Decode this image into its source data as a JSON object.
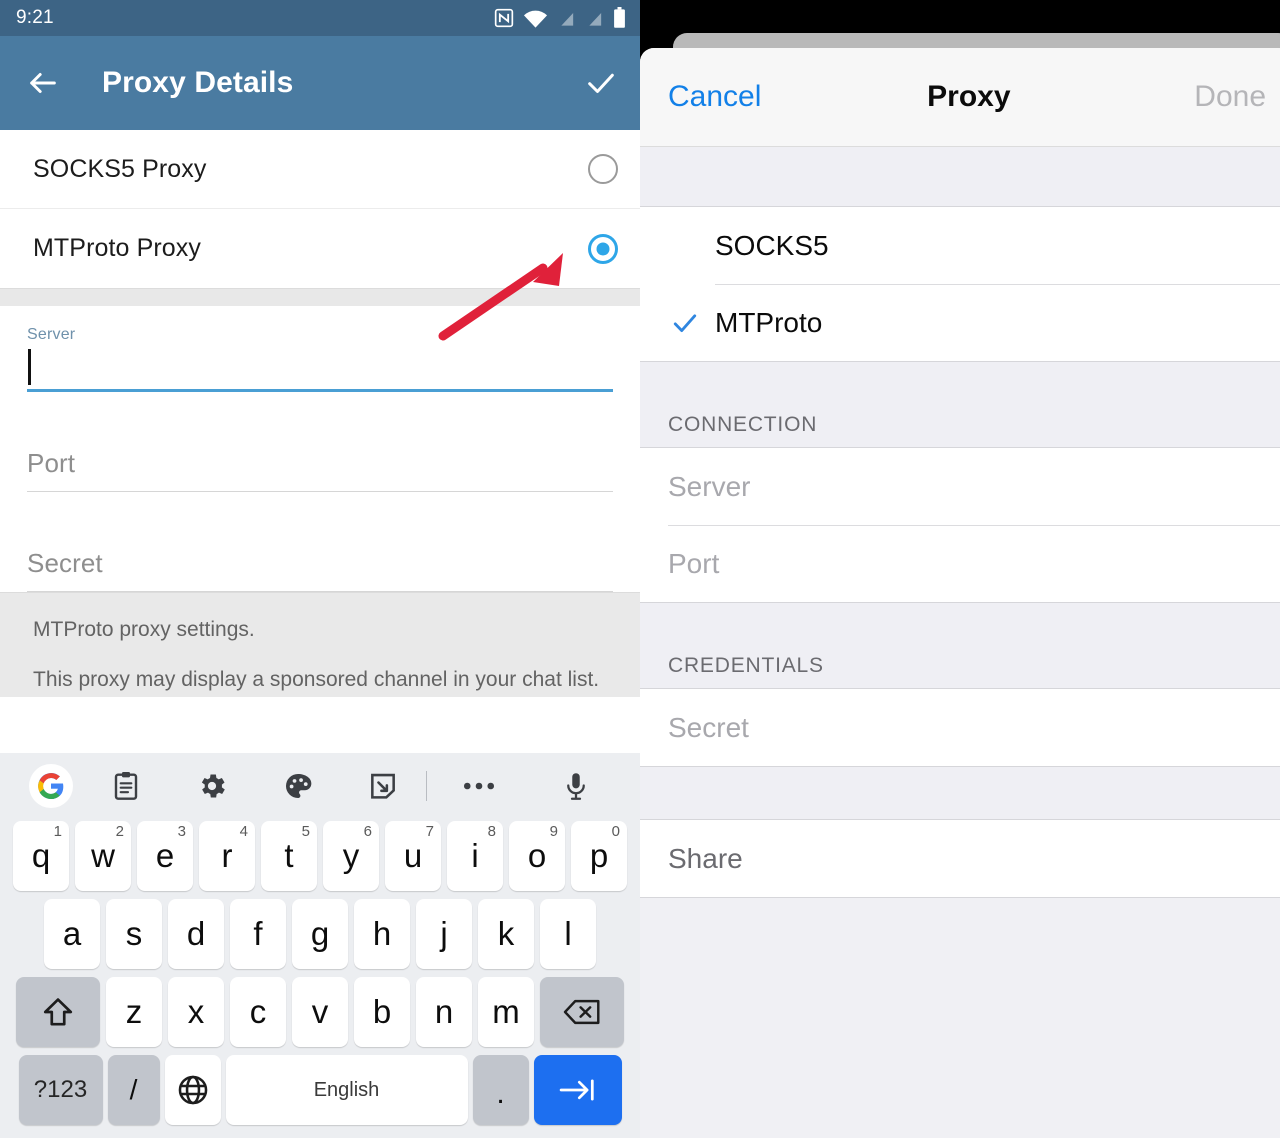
{
  "android": {
    "status_bar": {
      "time": "9:21",
      "icons": [
        "nfc-icon",
        "wifi-icon",
        "signal-disabled-icon",
        "signal-disabled-icon",
        "battery-icon"
      ]
    },
    "app_bar": {
      "back_icon": "arrow-left-icon",
      "title": "Proxy Details",
      "confirm_icon": "check-icon",
      "background": "#4a7ba1"
    },
    "proxy_types": [
      {
        "label": "SOCKS5 Proxy",
        "selected": false
      },
      {
        "label": "MTProto Proxy",
        "selected": true
      }
    ],
    "accent": "#2ea6e8",
    "form": {
      "server": {
        "float_label": "Server",
        "value": "",
        "focused": true
      },
      "port": {
        "placeholder": "Port",
        "value": ""
      },
      "secret": {
        "placeholder": "Secret",
        "value": ""
      }
    },
    "note": {
      "line1": "MTProto proxy settings.",
      "line2": "This proxy may display a sponsored channel in your chat list. This doesn't reveal any of your Telegram traffic."
    },
    "keyboard": {
      "toolbar_icons": [
        "google-icon",
        "clipboard-icon",
        "gear-icon",
        "palette-icon",
        "handwriting-icon",
        "more-icon",
        "microphone-icon"
      ],
      "row1": [
        {
          "key": "q",
          "num": "1"
        },
        {
          "key": "w",
          "num": "2"
        },
        {
          "key": "e",
          "num": "3"
        },
        {
          "key": "r",
          "num": "4"
        },
        {
          "key": "t",
          "num": "5"
        },
        {
          "key": "y",
          "num": "6"
        },
        {
          "key": "u",
          "num": "7"
        },
        {
          "key": "i",
          "num": "8"
        },
        {
          "key": "o",
          "num": "9"
        },
        {
          "key": "p",
          "num": "0"
        }
      ],
      "row2": [
        "a",
        "s",
        "d",
        "f",
        "g",
        "h",
        "j",
        "k",
        "l"
      ],
      "row3_keys": [
        "z",
        "x",
        "c",
        "v",
        "b",
        "n",
        "m"
      ],
      "shift_icon": "shift-icon",
      "backspace_icon": "backspace-icon",
      "symbols_label": "?123",
      "slash_label": "/",
      "globe_icon": "globe-icon",
      "space_label": "English",
      "period_label": ".",
      "enter_icon": "tab-next-icon",
      "enter_color": "#1d6ff0"
    }
  },
  "ios": {
    "nav": {
      "cancel_label": "Cancel",
      "title": "Proxy",
      "done_label": "Done",
      "cancel_color": "#1280e8",
      "done_color": "#b5b5b8"
    },
    "proxy_types": [
      {
        "label": "SOCKS5",
        "selected": false
      },
      {
        "label": "MTProto",
        "selected": true
      }
    ],
    "check_icon": "check-icon",
    "check_color": "#2f86e0",
    "sections": [
      {
        "header": "CONNECTION",
        "rows": [
          {
            "label": "Server",
            "style": "placeholder"
          },
          {
            "label": "Port",
            "style": "placeholder"
          }
        ]
      },
      {
        "header": "CREDENTIALS",
        "rows": [
          {
            "label": "Secret",
            "style": "placeholder"
          }
        ]
      },
      {
        "header": "",
        "rows": [
          {
            "label": "Share",
            "style": "share"
          }
        ]
      }
    ]
  },
  "annotations": [
    {
      "name": "arrow-to-mtproto-radio",
      "color": "#e0213a",
      "style": "thin-diagonal"
    },
    {
      "name": "arrow-to-mtproto-row",
      "color": "#df3613",
      "style": "thick-diagonal"
    }
  ]
}
